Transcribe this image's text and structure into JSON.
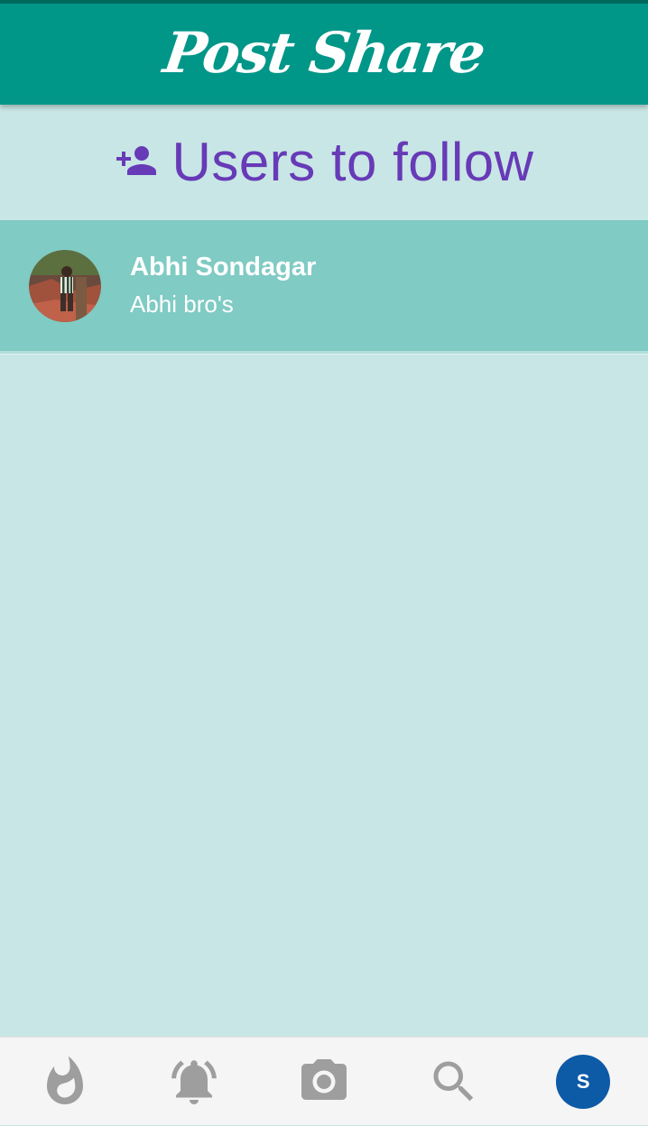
{
  "app": {
    "title": "Post Share",
    "primary_color": "#009688",
    "accent_color": "#673ab7"
  },
  "section": {
    "title": "Users to follow",
    "icon": "person-add-icon"
  },
  "users": [
    {
      "name": "Abhi Sondagar",
      "bio": "Abhi bro's",
      "avatar": "user-photo"
    }
  ],
  "bottom_nav": {
    "items": [
      {
        "name": "trending",
        "icon": "flame-icon"
      },
      {
        "name": "notifications",
        "icon": "bell-icon"
      },
      {
        "name": "camera",
        "icon": "camera-icon"
      },
      {
        "name": "search",
        "icon": "search-icon"
      },
      {
        "name": "profile",
        "icon": "profile-avatar",
        "initial": "S",
        "color": "#0d5aa7"
      }
    ]
  }
}
